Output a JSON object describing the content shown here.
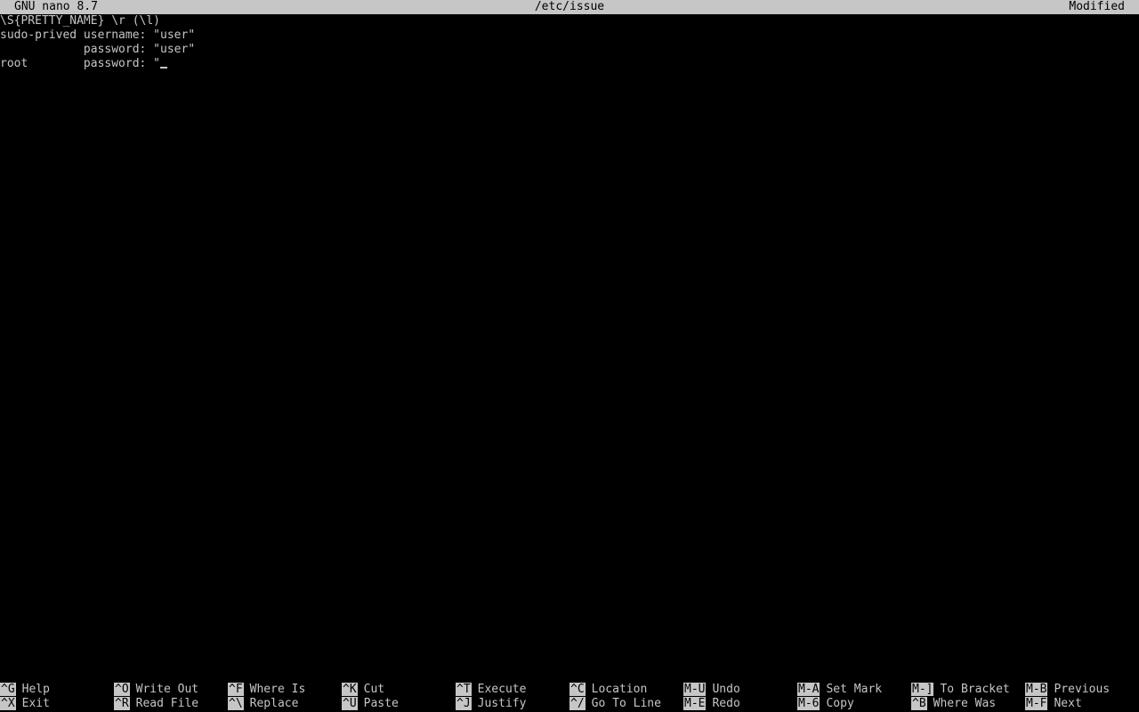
{
  "titlebar": {
    "app": "GNU nano 8.7",
    "filename": "/etc/issue",
    "status": "Modified"
  },
  "editor": {
    "lines": [
      "\\S{PRETTY_NAME} \\r (\\l)",
      "sudo-prived username: \"user\"",
      "            password: \"user\"",
      "root        password: \""
    ]
  },
  "shortcuts": {
    "row1": [
      {
        "key": "^G",
        "label": "Help"
      },
      {
        "key": "^O",
        "label": "Write Out"
      },
      {
        "key": "^F",
        "label": "Where Is"
      },
      {
        "key": "^K",
        "label": "Cut"
      },
      {
        "key": "^T",
        "label": "Execute"
      },
      {
        "key": "^C",
        "label": "Location"
      },
      {
        "key": "M-U",
        "label": "Undo"
      },
      {
        "key": "M-A",
        "label": "Set Mark"
      },
      {
        "key": "M-]",
        "label": "To Bracket"
      },
      {
        "key": "M-B",
        "label": "Previous"
      }
    ],
    "row2": [
      {
        "key": "^X",
        "label": "Exit"
      },
      {
        "key": "^R",
        "label": "Read File"
      },
      {
        "key": "^\\",
        "label": "Replace"
      },
      {
        "key": "^U",
        "label": "Paste"
      },
      {
        "key": "^J",
        "label": "Justify"
      },
      {
        "key": "^/",
        "label": "Go To Line"
      },
      {
        "key": "M-E",
        "label": "Redo"
      },
      {
        "key": "M-6",
        "label": "Copy"
      },
      {
        "key": "^B",
        "label": "Where Was"
      },
      {
        "key": "M-F",
        "label": "Next"
      }
    ]
  }
}
